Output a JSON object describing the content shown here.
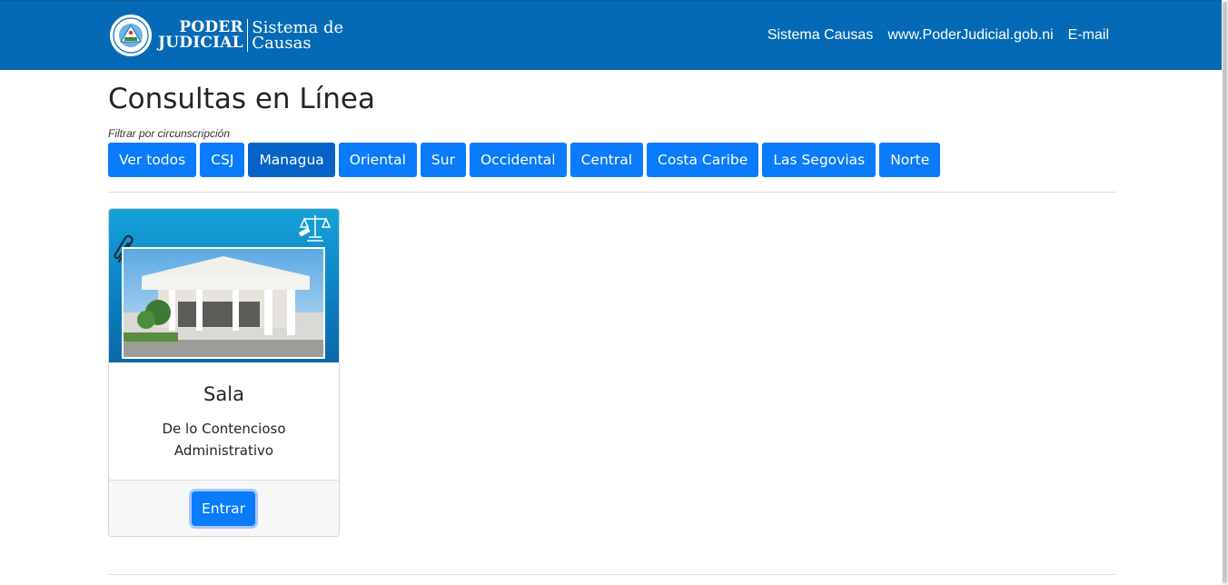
{
  "header": {
    "brand_line1": "PODER",
    "brand_line2": "JUDICIAL",
    "brand_system1": "Sistema de",
    "brand_system2": "Causas",
    "links": [
      "Sistema Causas",
      "www.PoderJudicial.gob.ni",
      "E-mail"
    ],
    "color": "#046ab5"
  },
  "main": {
    "title": "Consultas en Línea",
    "filter_label": "Filtrar por circunscripción",
    "filters": [
      "Ver todos",
      "CSJ",
      "Managua",
      "Oriental",
      "Sur",
      "Occidental",
      "Central",
      "Costa Caribe",
      "Las Segovias",
      "Norte"
    ],
    "active_filter": "Managua"
  },
  "card": {
    "title": "Sala",
    "subtitle_line1": "De lo Contencioso",
    "subtitle_line2": "Administrativo",
    "button": "Entrar",
    "icons": [
      "paperclip-icon",
      "justice-scales-icon"
    ]
  },
  "colors": {
    "primary_button": "#0a7bfb",
    "active_button": "#0563c8"
  }
}
